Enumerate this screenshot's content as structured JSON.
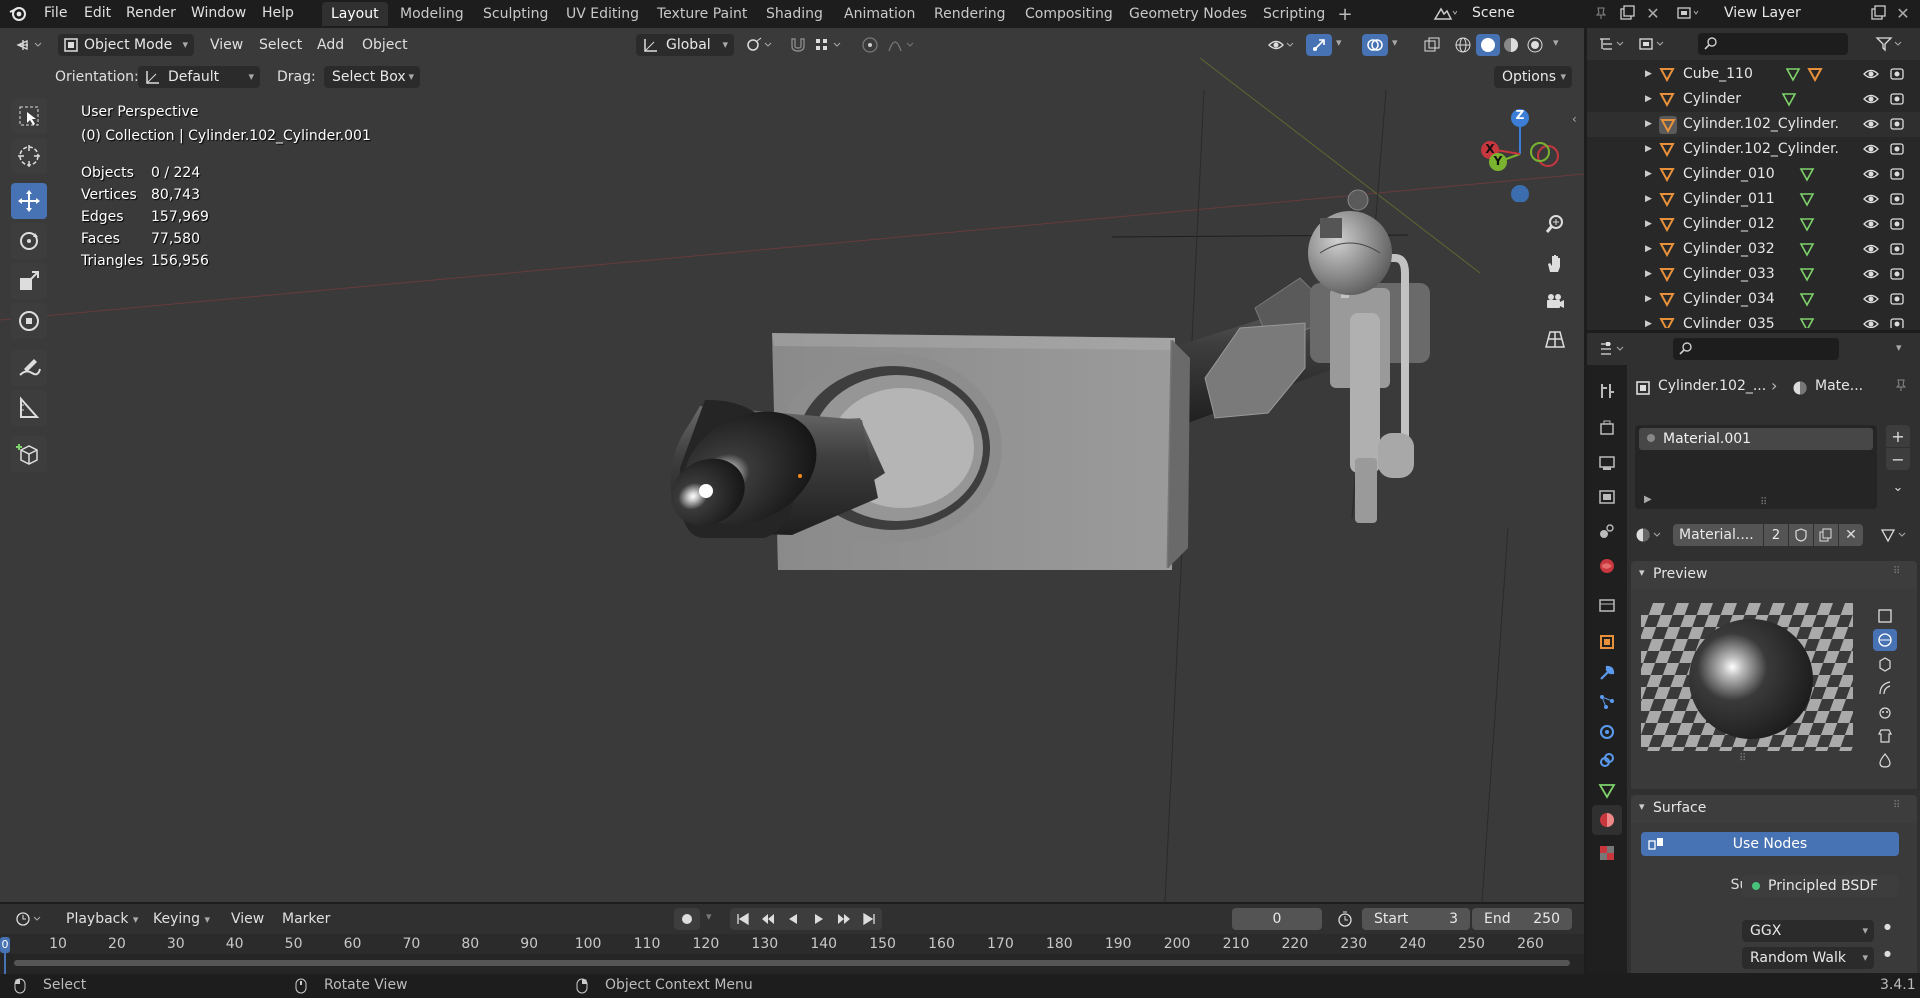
{
  "topbar": {
    "menus": [
      "File",
      "Edit",
      "Render",
      "Window",
      "Help"
    ],
    "workspaces": [
      "Layout",
      "Modeling",
      "Sculpting",
      "UV Editing",
      "Texture Paint",
      "Shading",
      "Animation",
      "Rendering",
      "Compositing",
      "Geometry Nodes",
      "Scripting"
    ],
    "active_workspace": "Layout",
    "scene": "Scene",
    "view_layer": "View Layer"
  },
  "viewport_header": {
    "mode": "Object Mode",
    "menus": [
      "View",
      "Select",
      "Add",
      "Object"
    ],
    "transform_orientation": "Global",
    "orientation_label": "Orientation:",
    "orientation_value": "Default",
    "drag_label": "Drag:",
    "drag_value": "Select Box",
    "options": "Options"
  },
  "overlay": {
    "view_name": "User Perspective",
    "collection": "(0) Collection | Cylinder.102_Cylinder.001",
    "stats": [
      {
        "label": "Objects",
        "value": "0 / 224"
      },
      {
        "label": "Vertices",
        "value": "80,743"
      },
      {
        "label": "Edges",
        "value": "157,969"
      },
      {
        "label": "Faces",
        "value": "77,580"
      },
      {
        "label": "Triangles",
        "value": "156,956"
      }
    ]
  },
  "gizmo": {
    "x": "X",
    "y": "Y",
    "z": "Z"
  },
  "outliner": {
    "items": [
      "Cube_110",
      "Cylinder",
      "Cylinder.102_Cylinder.",
      "Cylinder.102_Cylinder.",
      "Cylinder_010",
      "Cylinder_011",
      "Cylinder_012",
      "Cylinder_032",
      "Cylinder_033",
      "Cylinder_034",
      "Cylinder_035"
    ]
  },
  "properties": {
    "breadcrumb_object": "Cylinder.102_...",
    "breadcrumb_material": "Mate...",
    "material_slot": "Material.001",
    "material_name": "Material....",
    "user_count": "2",
    "preview_label": "Preview",
    "surface_label": "Surface",
    "use_nodes": "Use Nodes",
    "surface_field_label": "Surface",
    "surface_value": "Principled BSDF",
    "distribution": "GGX",
    "subsurface": "Random Walk"
  },
  "timeline": {
    "menus": [
      "Playback",
      "Keying",
      "View",
      "Marker"
    ],
    "current_frame": "0",
    "start_label": "Start",
    "start_value": "3",
    "end_label": "End",
    "end_value": "250",
    "ticks": [
      "10",
      "20",
      "30",
      "40",
      "50",
      "60",
      "70",
      "80",
      "90",
      "100",
      "110",
      "120",
      "130",
      "140",
      "150",
      "160",
      "170",
      "180",
      "190",
      "200",
      "210",
      "220",
      "230",
      "240",
      "250",
      "260"
    ],
    "playhead": "0"
  },
  "statusbar": {
    "select": "Select",
    "rotate": "Rotate View",
    "context": "Object Context Menu",
    "version": "3.4.1"
  },
  "colors": {
    "accent": "#4772b3",
    "object_orange": "#e8913a",
    "mesh_green": "#7fd36b",
    "axis_red": "#c8363e",
    "axis_green": "#7ab330",
    "axis_blue": "#3d7fd6"
  }
}
